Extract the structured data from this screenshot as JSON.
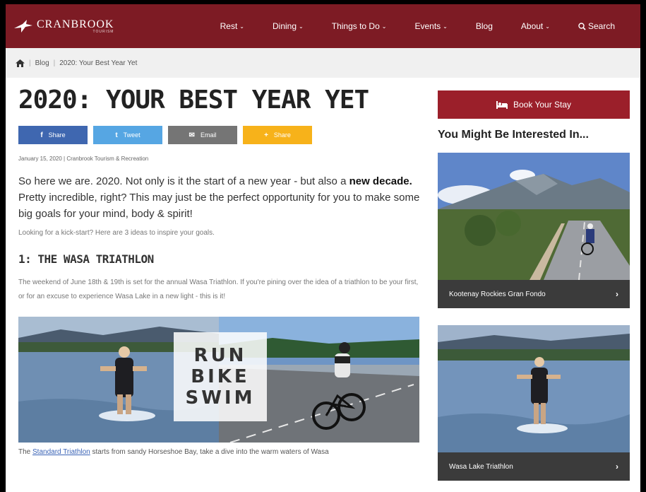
{
  "header": {
    "logo_name": "CRANBROOK",
    "logo_sub": "TOURISM",
    "nav": [
      {
        "label": "Rest",
        "chev": "⌄"
      },
      {
        "label": "Dining",
        "chev": "⌄"
      },
      {
        "label": "Things to Do",
        "chev": "⌄"
      },
      {
        "label": "Events",
        "chev": "⌄"
      },
      {
        "label": "Blog",
        "chev": ""
      },
      {
        "label": "About",
        "chev": "⌄"
      },
      {
        "label": "Search",
        "chev": ""
      }
    ]
  },
  "breadcrumb": {
    "items": [
      "Blog",
      "2020: Your Best Year Yet"
    ],
    "sep": "|"
  },
  "article": {
    "title": "2020: YOUR BEST YEAR YET",
    "share": [
      {
        "icon": "f",
        "label": "Share"
      },
      {
        "icon": "t",
        "label": "Tweet"
      },
      {
        "icon": "✉",
        "label": "Email"
      },
      {
        "icon": "+",
        "label": "Share"
      }
    ],
    "meta": "January 15, 2020 | Cranbrook Tourism & Recreation",
    "lead_1": "So here we are. 2020. Not only is it the start of a new year - but also a",
    "lead_bold": "new decade.",
    "lead_2": " Pretty incredible, right? This may just be the perfect opportunity for you to make some big goals for your mind, body & spirit!",
    "kick": "Looking for a kick-start? Here are 3 ideas to inspire your goals.",
    "section_heading": "1: THE WASA TRIATHLON",
    "para": "The weekend of June 18th & 19th is set for the annual Wasa Triathlon. If you're pining over the idea of a triathlon to be your first, or for an excuse to experience Wasa Lake in a new light - this is it!",
    "hero_words": [
      "RUN",
      "BIKE",
      "SWIM"
    ],
    "foot_pre": "The ",
    "foot_link": "Standard Triathlon",
    "foot_post": " starts from sandy Horseshoe Bay, take a dive into the warm waters of Wasa"
  },
  "sidebar": {
    "book_label": "Book Your Stay",
    "heading": "You Might Be Interested In...",
    "cards": [
      {
        "title": "Kootenay Rockies Gran Fondo",
        "arrow": "›"
      },
      {
        "title": "Wasa Lake Triathlon",
        "arrow": "›"
      }
    ]
  }
}
